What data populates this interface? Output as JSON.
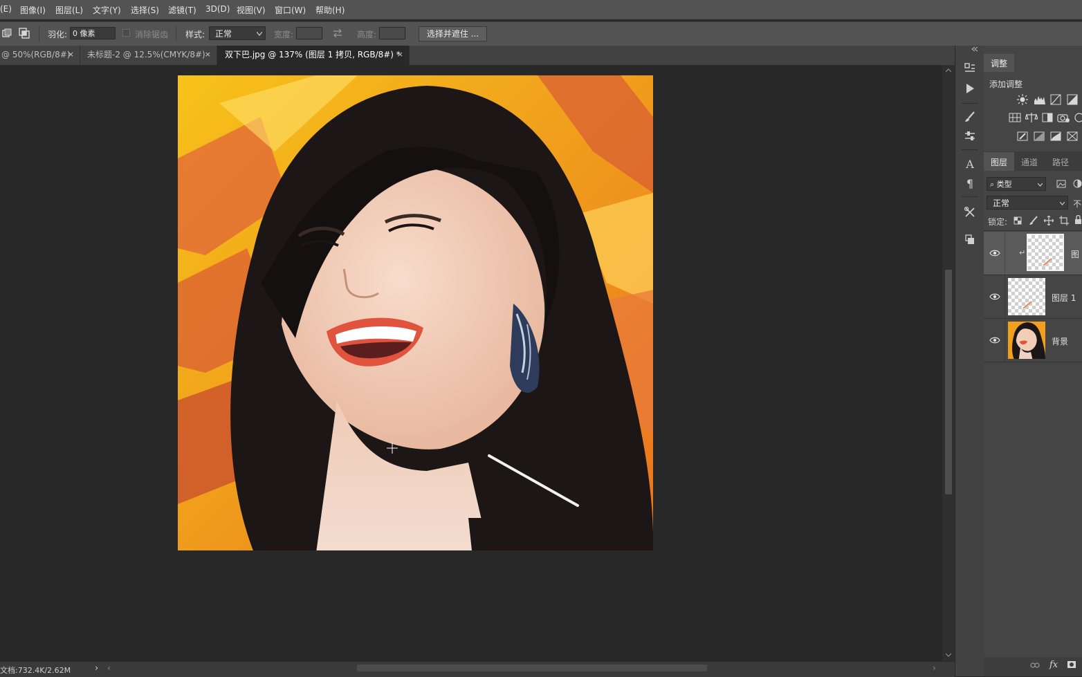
{
  "menu": [
    "(E)",
    "图像(I)",
    "图层(L)",
    "文字(Y)",
    "选择(S)",
    "滤镜(T)",
    "3D(D)",
    "视图(V)",
    "窗口(W)",
    "帮助(H)"
  ],
  "options": {
    "feather_label": "羽化:",
    "feather_value": "0 像素",
    "antialias_label": "消除锯齿",
    "style_label": "样式:",
    "style_value": "正常",
    "width_label": "宽度:",
    "height_label": "高度:",
    "select_mask_button": "选择并遮住 ..."
  },
  "tabs": [
    {
      "label": "@ 50%(RGB/8#)",
      "close": "×"
    },
    {
      "label": "未标题-2 @ 12.5%(CMYK/8#)",
      "close": "×"
    },
    {
      "label": "双下巴.jpg @ 137% (图层 1 拷贝, RGB/8#) *",
      "close": "×",
      "active": true
    }
  ],
  "status": {
    "doc_info": "文档:732.4K/2.62M",
    "arrow": "›"
  },
  "adjustments": {
    "tab_label": "调整",
    "add_label": "添加调整"
  },
  "layers_panel": {
    "tabs": [
      "图层",
      "通道",
      "路径"
    ],
    "filter_kind": "类型",
    "blend_mode": "正常",
    "opacity_label_cut": "不",
    "lock_label": "锁定:",
    "layers": [
      {
        "name": "图",
        "visible": true,
        "selected": true,
        "type": "transparent"
      },
      {
        "name": "图层 1",
        "visible": true,
        "selected": false,
        "type": "transparent"
      },
      {
        "name": "背景",
        "visible": true,
        "selected": false,
        "type": "photo"
      }
    ]
  },
  "colors": {
    "app_bg": "#535353",
    "canvas_bg": "#282828",
    "panel_bg": "#454545",
    "selected_layer": "#5a5a5a"
  }
}
